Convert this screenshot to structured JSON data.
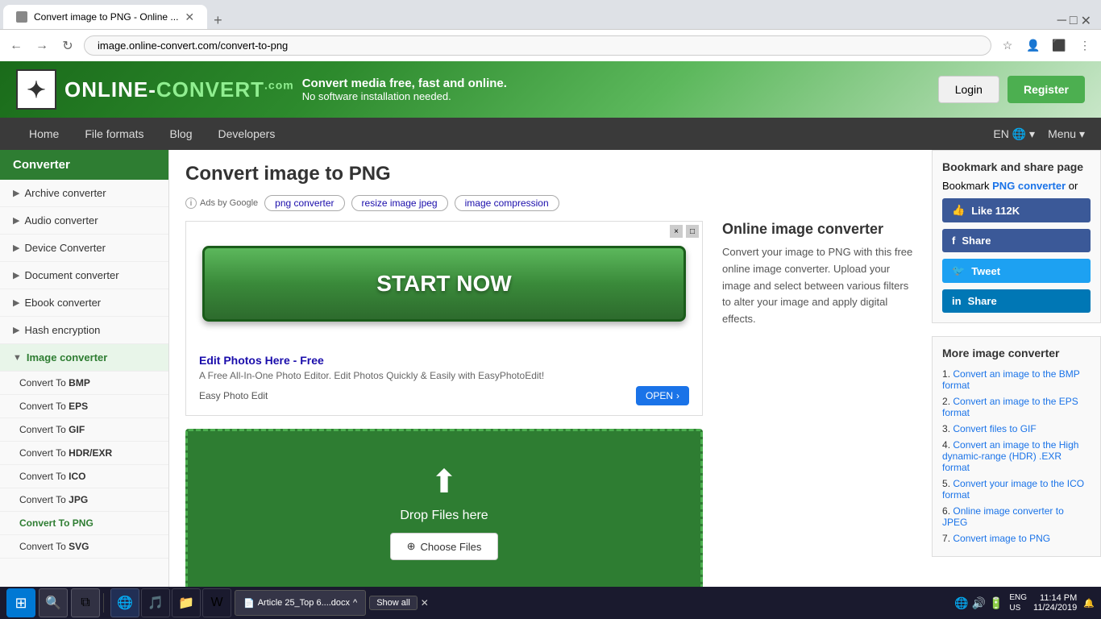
{
  "browser": {
    "url": "image.online-convert.com/convert-to-png",
    "tab_title": "Convert image to PNG - Online ...",
    "nav_back": "←",
    "nav_forward": "→",
    "nav_refresh": "↻"
  },
  "site": {
    "logo_icon": "✦",
    "logo_text": "ONLINE-CONVERT",
    "logo_com": ".com",
    "tagline_main": "Convert media free, fast and online.",
    "tagline_sub": "No software installation needed.",
    "btn_login": "Login",
    "btn_register": "Register"
  },
  "nav": {
    "items": [
      "Home",
      "File formats",
      "Blog",
      "Developers"
    ],
    "lang": "EN",
    "menu": "Menu"
  },
  "sidebar": {
    "header": "Converter",
    "items": [
      {
        "label": "Archive converter",
        "sub": []
      },
      {
        "label": "Audio converter",
        "sub": []
      },
      {
        "label": "Device Converter",
        "sub": []
      },
      {
        "label": "Document converter",
        "sub": []
      },
      {
        "label": "Ebook converter",
        "sub": []
      },
      {
        "label": "Hash encryption",
        "sub": []
      },
      {
        "label": "Image converter",
        "active": true,
        "sub": [
          {
            "label": "Convert To BMP"
          },
          {
            "label": "Convert To EPS"
          },
          {
            "label": "Convert To GIF"
          },
          {
            "label": "Convert To HDR/EXR"
          },
          {
            "label": "Convert To ICO"
          },
          {
            "label": "Convert To JPG"
          },
          {
            "label": "Convert To PNG",
            "active": true
          },
          {
            "label": "Convert To SVG"
          }
        ]
      }
    ]
  },
  "page": {
    "title": "Convert image to PNG",
    "ads_label": "Ads by Google",
    "ad_tags": [
      "png converter",
      "resize image jpeg",
      "image compression"
    ]
  },
  "ad_box": {
    "title": "Edit Photos Here - Free",
    "description": "A Free All-In-One Photo Editor. Edit Photos Quickly & Easily with EasyPhotoEdit!",
    "source": "Easy Photo Edit",
    "open_btn": "OPEN",
    "start_now": "START NOW"
  },
  "converter": {
    "title": "Online image converter",
    "description": "Convert your image to PNG with this free online image converter. Upload your image and select between various filters to alter your image and apply digital effects."
  },
  "dropzone": {
    "text": "Drop Files here",
    "btn": "Choose Files"
  },
  "bookmark": {
    "title": "Bookmark and share page",
    "prefix": "Bookmark ",
    "link_text": "PNG converter",
    "suffix": " or",
    "like_count": "Like 112K",
    "share": "Share",
    "tweet": "Tweet",
    "share2": "Share"
  },
  "more_converter": {
    "title": "More image converter",
    "items": [
      "Convert an image to the BMP format",
      "Convert an image to the EPS format",
      "Convert files to GIF",
      "Convert an image to the High dynamic-range (HDR) .EXR format",
      "Convert your image to the ICO format",
      "Online image converter to JPEG",
      "Convert image to PNG"
    ]
  },
  "taskbar": {
    "doc_label": "Article 25_Top 6....docx",
    "show_all": "Show all",
    "time": "11:14 PM",
    "date": "11/24/2019",
    "lang": "ENG\nUS"
  }
}
